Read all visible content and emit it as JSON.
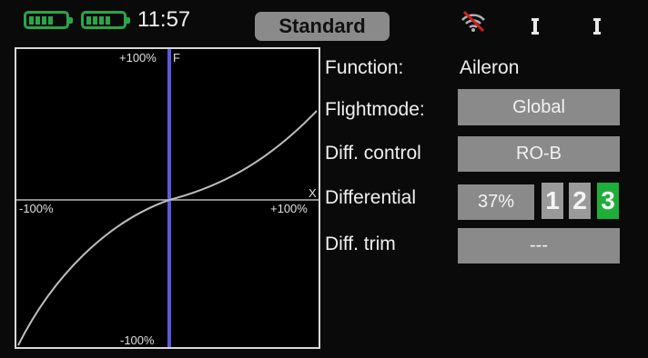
{
  "status": {
    "clock": "11:57",
    "model_name": "Standard",
    "battery_color": "#2aa64a"
  },
  "graph": {
    "y_top": "+100%",
    "y_bottom": "-100%",
    "x_left": "-100%",
    "x_right": "+100%",
    "axis_f": "F",
    "axis_x": "X",
    "cursor_color": "#5a5adc",
    "curve_color": "#bdbdbd"
  },
  "settings": {
    "function_label": "Function:",
    "function_value": "Aileron",
    "flightmode_label": "Flightmode:",
    "flightmode_value": "Global",
    "diffcontrol_label": "Diff. control",
    "diffcontrol_value": "RO-B",
    "differential_label": "Differential",
    "differential_value": "37%",
    "difftrim_label": "Diff. trim",
    "difftrim_value": "---"
  },
  "modes": {
    "items": [
      "1",
      "2",
      "3"
    ],
    "active": "3",
    "active_color": "#1fae3a"
  }
}
